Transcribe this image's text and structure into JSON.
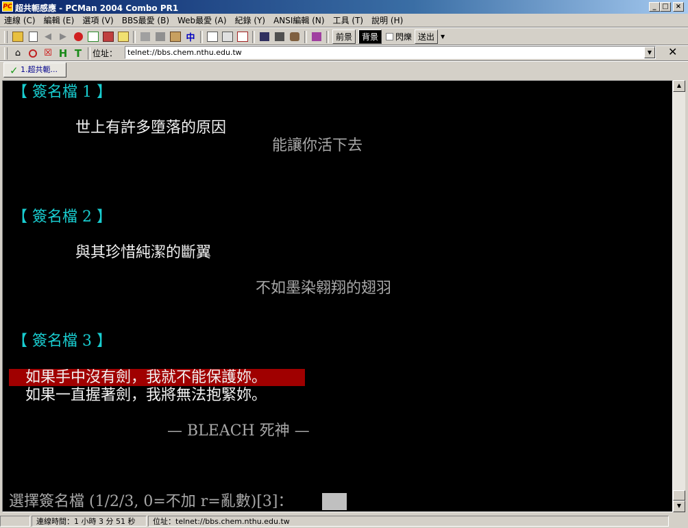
{
  "window": {
    "icon_text": "PC",
    "title": "超共軛感應 - PCMan 2004 Combo PR1",
    "min_label": "_",
    "max_label": "□",
    "close_label": "×"
  },
  "menu": [
    "連線 (C)",
    "編輯 (E)",
    "選項 (V)",
    "BBS最愛 (B)",
    "Web最愛 (A)",
    "紀錄 (Y)",
    "ANSI編輯 (N)",
    "工具 (T)",
    "說明 (H)"
  ],
  "toolbar": {
    "foreground_label": "前景",
    "background_label": "背景",
    "blink_label": "閃爍",
    "send_label": "送出"
  },
  "address": {
    "h_label": "H",
    "t_label": "T",
    "label": "位址：",
    "value": "telnet://bbs.chem.nthu.edu.tw",
    "close_label": "✕"
  },
  "tab": {
    "label": "1.超共軛..."
  },
  "terminal": {
    "sig1_header": "【 簽名檔 1 】",
    "sig1_line1": "世上有許多墮落的原因",
    "sig1_line2": "能讓你活下去",
    "sig2_header": "【 簽名檔 2 】",
    "sig2_line1": "與其珍惜純潔的斷翼",
    "sig2_line2": "不如墨染翱翔的翅羽",
    "sig3_header": "【 簽名檔 3 】",
    "sig3_line1": "如果手中沒有劍，我就不能保護妳。",
    "sig3_line2": "如果一直握著劍，我將無法抱緊妳。",
    "sig3_credit": "— BLEACH 死神 —",
    "prompt": "選擇簽名檔 (1/2/3, 0=不加 r=亂數)[3]："
  },
  "status": {
    "connect_time": "連線時間：1 小時 3 分 51 秒",
    "address": "位址：telnet://bbs.chem.nthu.edu.tw"
  }
}
